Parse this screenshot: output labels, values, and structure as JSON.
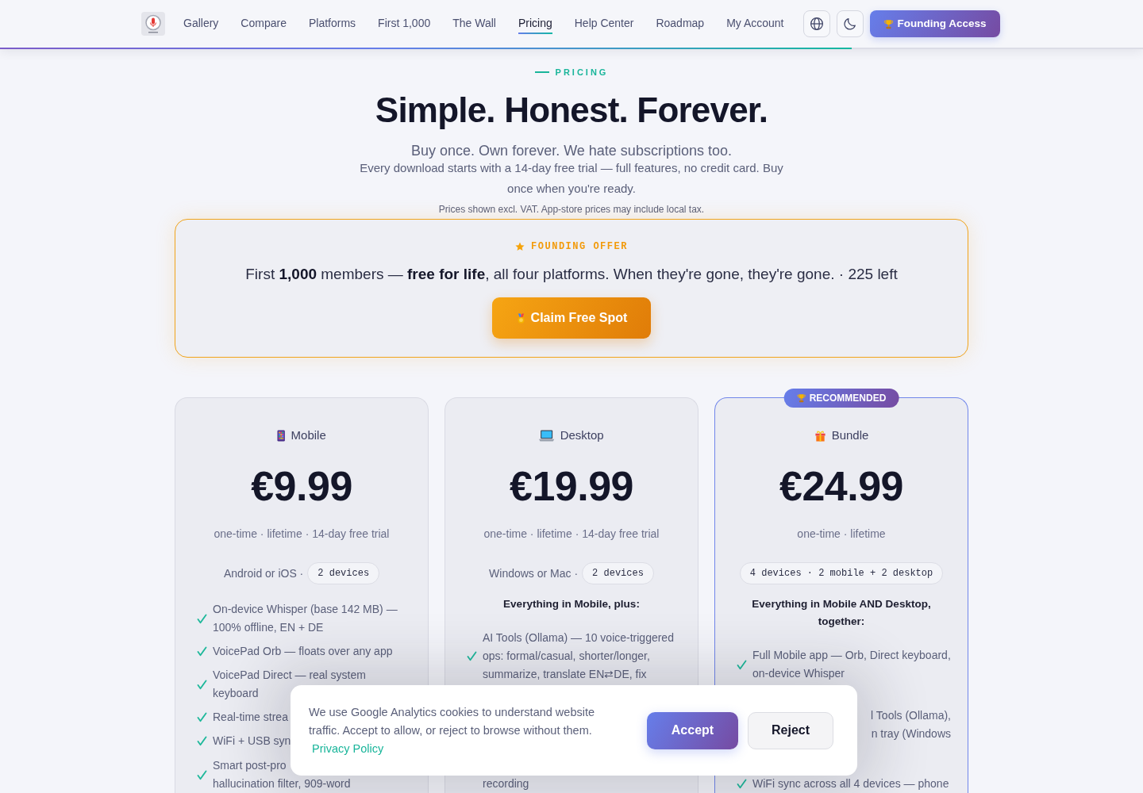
{
  "nav": {
    "links": [
      {
        "label": "Gallery",
        "selected": false
      },
      {
        "label": "Compare",
        "selected": false
      },
      {
        "label": "Platforms",
        "selected": false
      },
      {
        "label": "First 1,000",
        "selected": false
      },
      {
        "label": "The Wall",
        "selected": false
      },
      {
        "label": "Pricing",
        "selected": true
      },
      {
        "label": "Help Center",
        "selected": false
      },
      {
        "label": "Roadmap",
        "selected": false
      },
      {
        "label": "My Account",
        "selected": false
      }
    ],
    "cta": "Founding Access"
  },
  "reading_progress": {
    "level": 0.745
  },
  "header": {
    "eyebrow": "PRICING",
    "title": "Simple. Honest. Forever.",
    "subtitle": "Buy once. Own forever. We hate subscriptions too.",
    "intro": "Every download starts with a 14-day free trial — full features, no credit card. Buy once when you're ready.",
    "note": "Prices shown excl. VAT. App-store prices may include local tax."
  },
  "founding_offer": {
    "label": "FOUNDING OFFER",
    "text": "First **1,000** members — **free for life**, all four platforms. When they're gone, they're gone. · 225 left",
    "button": "Claim Free Spot"
  },
  "plans": [
    {
      "kind": "mobile",
      "name": "Mobile",
      "recommended": false,
      "price": "€9.99",
      "terms": "one-time · lifetime · 14-day free trial",
      "platforms": "Android or iOS ·",
      "devices": "2 devices",
      "features": [
        {
          "kind": "full",
          "text": "On-device Whisper (base 142 MB) — 100% offline, EN + DE"
        },
        {
          "kind": "full",
          "text": "VoicePad Orb — floats over any app"
        },
        {
          "kind": "full",
          "text": "VoicePad Direct — real system keyboard"
        },
        {
          "kind": "cut_end",
          "lines": [
            "Real-time strea"
          ]
        },
        {
          "kind": "cut_end",
          "lines": [
            "WiFi + USB syn"
          ]
        },
        {
          "kind": "cut_end",
          "lines": [
            "Smart post-pro",
            "hallucination filter, 909-word"
          ]
        }
      ]
    },
    {
      "kind": "desktop",
      "name": "Desktop",
      "recommended": false,
      "price": "€19.99",
      "terms": "one-time · lifetime · 14-day free trial",
      "platforms": "Windows or Mac ·",
      "devices": "2 devices",
      "includes": "Everything in Mobile, plus:",
      "features": [
        {
          "kind": "full",
          "text": "AI Tools (Ollama) — 10 voice-triggered ops: formal/casual, shorter/longer, summarize, translate EN⇄DE, fix"
        },
        {
          "kind": "tail",
          "lines": [
            "recording"
          ]
        }
      ]
    },
    {
      "kind": "bundle",
      "name": "Bundle",
      "recommended": true,
      "badge": "RECOMMENDED",
      "price": "€24.99",
      "terms": "one-time · lifetime",
      "devices": "4 devices · 2 mobile + 2 desktop",
      "includes": "Everything in Mobile AND Desktop, together:",
      "features": [
        {
          "kind": "full",
          "text": "Full Mobile app — Orb, Direct keyboard, on-device Whisper"
        },
        {
          "kind": "cut_start",
          "lines": [
            "l Tools (Ollama),",
            "n tray (Windows"
          ]
        },
        {
          "kind": "cut_end",
          "lines": [
            "WiFi sync across all 4 devices — phone"
          ]
        }
      ]
    }
  ],
  "cookie_banner": {
    "text": "We use Google Analytics cookies to understand website traffic. Accept to allow, or reject to browse without them.",
    "link": "Privacy Policy",
    "buttons": [
      {
        "label": "Accept",
        "kind": "primary"
      },
      {
        "label": "Reject",
        "kind": "secondary"
      }
    ]
  }
}
